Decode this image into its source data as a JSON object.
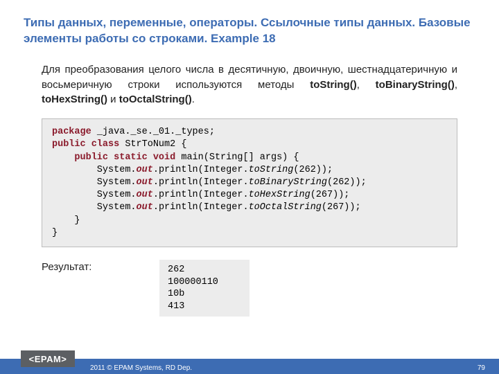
{
  "title": "Типы данных, переменные, операторы. Ссылочные типы данных. Базовые элементы работы со строками. Example 18",
  "paragraph": {
    "prefix": "Для преобразования целого числа в десятичную, двоичную, шестнадцатеричную и восьмеричную строки используются методы ",
    "m1": "toString()",
    "sep1": ", ",
    "m2": "toBinaryString()",
    "sep2": ", ",
    "m3": "toHexString()",
    "sep3": " и ",
    "m4": "toOctalString()",
    "suffix": "."
  },
  "code": {
    "kw_package": "package",
    "pkg_name": " _java._se._01._types;",
    "kw_public1": "public",
    "kw_class": " class",
    "class_name": " StrToNum2 {",
    "kw_public2": "public",
    "kw_static": " static",
    "kw_void": " void",
    "main_sig": " main(String[] args) {",
    "line1a": "        System.",
    "out": "out",
    "line1b": ".println(Integer.",
    "toString": "toString",
    "args1": "(262));",
    "line2b": ".println(Integer.",
    "toBinaryString": "toBinaryString",
    "args2": "(262));",
    "line3b": ".println(Integer.",
    "toHexString": "toHexString",
    "args3": "(267));",
    "line4b": ".println(Integer.",
    "toOctalString": "toOctalString",
    "args4": "(267));",
    "close1": "    }",
    "close2": "}"
  },
  "result_label": "Результат:",
  "output": "262\n100000110\n10b\n413",
  "footer": {
    "logo": "<EPAM>",
    "copy": "2011 © EPAM Systems, RD Dep.",
    "page": "79"
  }
}
